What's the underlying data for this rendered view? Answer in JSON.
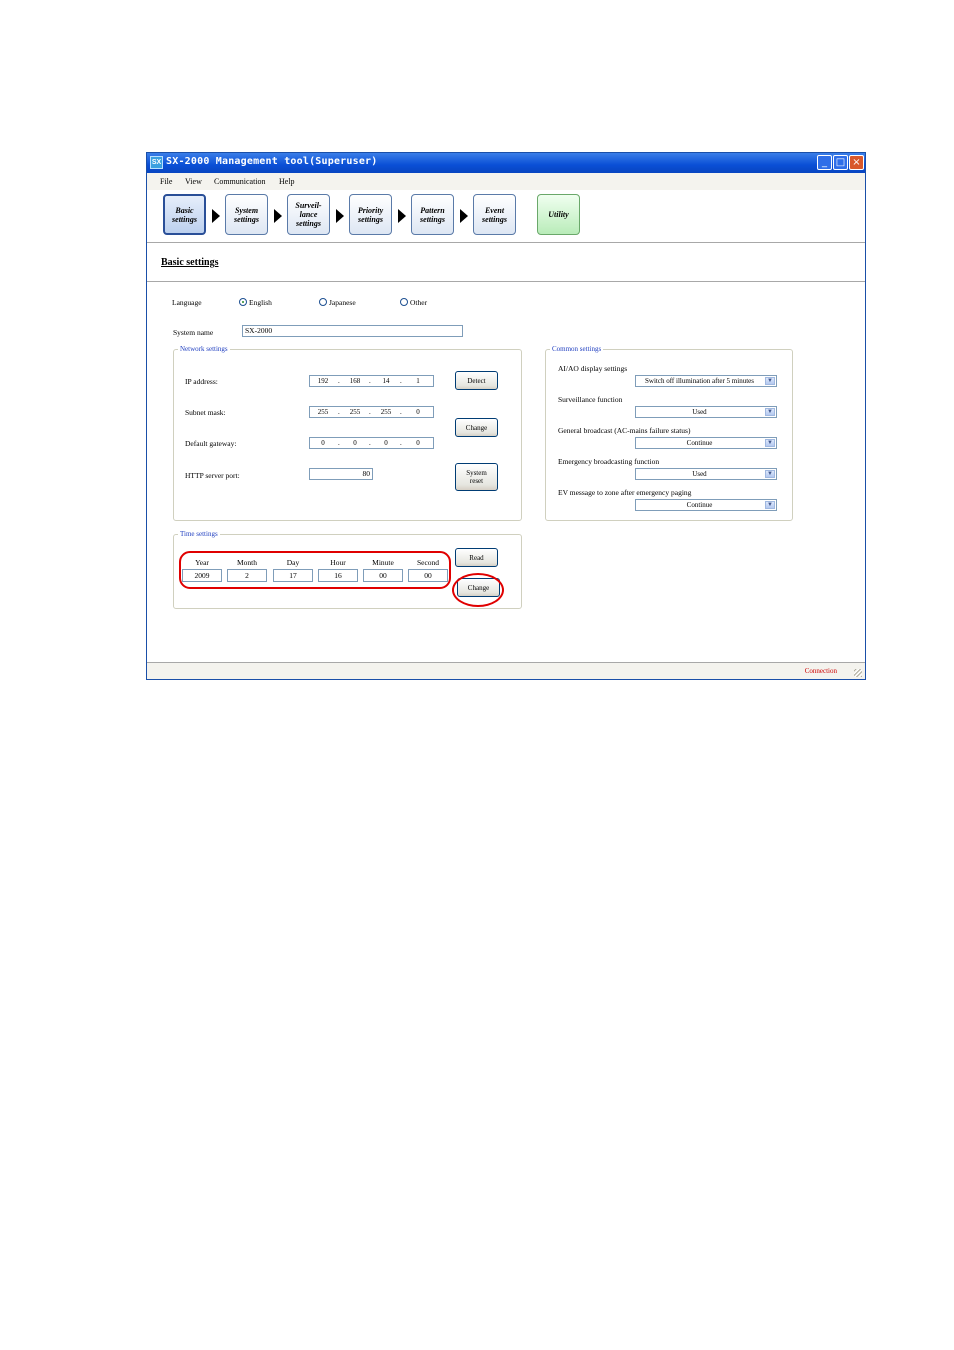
{
  "window": {
    "app_icon_text": "SX",
    "title": "SX-2000 Management tool(Superuser)",
    "controls": {
      "minimize": "_",
      "maximize": "□",
      "close": "×"
    }
  },
  "menu": [
    "File",
    "View",
    "Communication",
    "Help"
  ],
  "steps": [
    {
      "label": "Basic\nsettings"
    },
    {
      "label": "System\nsettings"
    },
    {
      "label": "Surveil-\nlance\nsettings"
    },
    {
      "label": "Priority\nsettings"
    },
    {
      "label": "Pattern\nsettings"
    },
    {
      "label": "Event\nsettings"
    },
    {
      "label": "Utility"
    }
  ],
  "page_title": "Basic settings",
  "language": {
    "label": "Language",
    "options": [
      "English",
      "Japanese",
      "Other"
    ],
    "selected": "English"
  },
  "system_name": {
    "label": "System name",
    "value": "SX-2000"
  },
  "network": {
    "title": "Network settings",
    "ip": {
      "label": "IP address:",
      "value": [
        "192",
        "168",
        "14",
        "1"
      ]
    },
    "subnet": {
      "label": "Subnet mask:",
      "value": [
        "255",
        "255",
        "255",
        "0"
      ]
    },
    "gateway": {
      "label": "Default gateway:",
      "value": [
        "0",
        "0",
        "0",
        "0"
      ]
    },
    "http_port": {
      "label": "HTTP server port:",
      "value": "80"
    },
    "buttons": {
      "detect": "Detect",
      "change": "Change",
      "reset": "System\nreset"
    }
  },
  "common": {
    "title": "Common settings",
    "rows": [
      {
        "label": "AI/AO display settings",
        "value": "Switch off illumination after 5 minutes"
      },
      {
        "label": "Surveillance function",
        "value": "Used"
      },
      {
        "label": "General broadcast (AC-mains failure status)",
        "value": "Continue"
      },
      {
        "label": "Emergency broadcasting function",
        "value": "Used"
      },
      {
        "label": "EV message to zone after emergency paging",
        "value": "Continue"
      }
    ]
  },
  "time": {
    "title": "Time settings",
    "fields": [
      {
        "label": "Year",
        "value": "2009"
      },
      {
        "label": "Month",
        "value": "2"
      },
      {
        "label": "Day",
        "value": "17"
      },
      {
        "label": "Hour",
        "value": "16"
      },
      {
        "label": "Minute",
        "value": "00"
      },
      {
        "label": "Second",
        "value": "00"
      }
    ],
    "buttons": {
      "read": "Read",
      "change": "Change"
    }
  },
  "status": {
    "connection": "Connection"
  },
  "colors": {
    "highlight": "#e00000",
    "titlebar": "#0a4fd6",
    "status_text": "#cc0000"
  }
}
